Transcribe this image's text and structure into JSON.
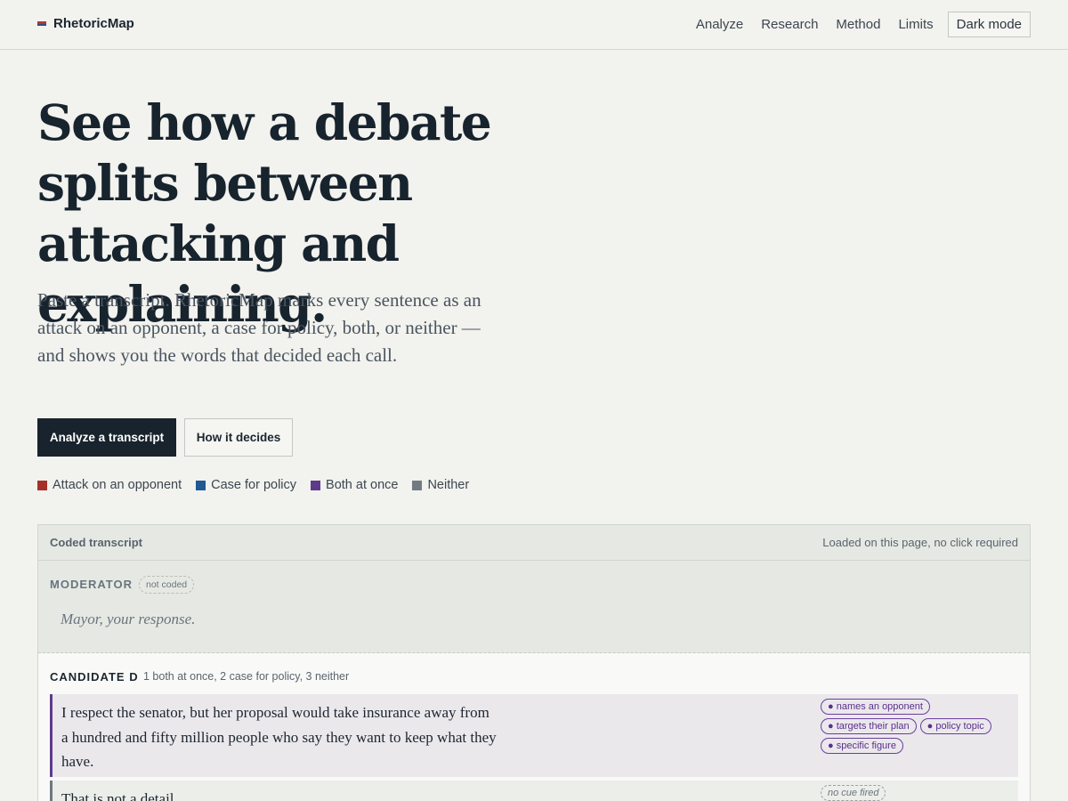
{
  "brand": {
    "name": "RhetoricMap"
  },
  "nav": {
    "items": [
      "Analyze",
      "Research",
      "Method",
      "Limits"
    ],
    "dark_mode": "Dark mode"
  },
  "hero": {
    "title": "See how a debate splits between attacking and explaining.",
    "subtitle": "Paste a transcript. RhetoricMap marks every sentence as an attack on an opponent, a case for policy, both, or neither — and shows you the words that decided each call.",
    "primary_cta": "Analyze a transcript",
    "secondary_cta": "How it decides"
  },
  "legend": [
    {
      "label": "Attack on an opponent",
      "color": "#a5302a"
    },
    {
      "label": "Case for policy",
      "color": "#1f5a94"
    },
    {
      "label": "Both at once",
      "color": "#5e3a8c"
    },
    {
      "label": "Neither",
      "color": "#737b82"
    }
  ],
  "transcript": {
    "title": "Coded transcript",
    "note": "Loaded on this page, no click required",
    "moderator": {
      "speaker": "MODERATOR",
      "badge": "not coded",
      "line": "Mayor, your response."
    },
    "candidate": {
      "speaker": "CANDIDATE D",
      "stats": "1 both at once, 2 case for policy, 3 neither",
      "sentences": [
        {
          "text": "I respect the senator, but her proposal would take insurance away from a hundred and fifty million people who say they want to keep what they have.",
          "cues": [
            "names an opponent",
            "targets their plan",
            "policy topic",
            "specific figure"
          ]
        },
        {
          "text": "That is not a detail.",
          "cue_none": "no cue fired"
        }
      ]
    }
  }
}
